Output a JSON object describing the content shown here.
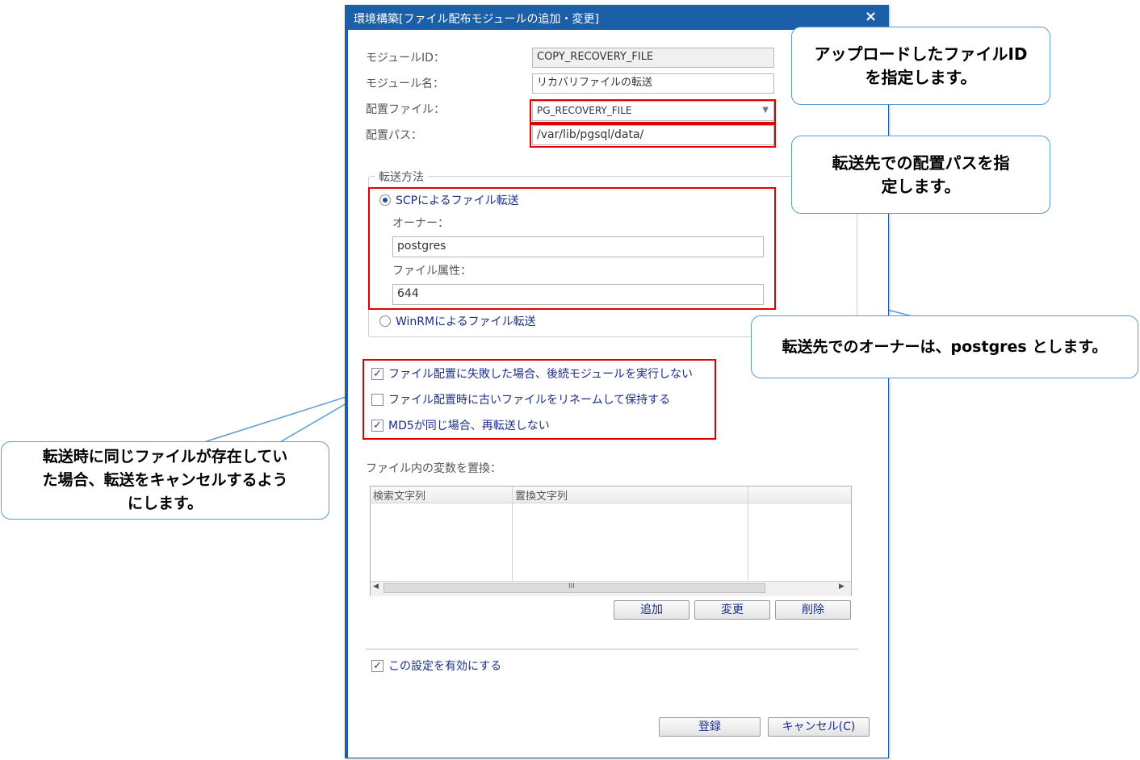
{
  "dialog": {
    "title": "環境構築[ファイル配布モジュールの追加・変更]",
    "close": "×"
  },
  "form": {
    "module_id_label": "モジュールID：",
    "module_id_value": "COPY_RECOVERY_FILE",
    "module_name_label": "モジュール名：",
    "module_name_value": "リカバリファイルの転送",
    "deploy_file_label": "配置ファイル：",
    "deploy_file_value": "PG_RECOVERY_FILE",
    "deploy_path_label": "配置パス：",
    "deploy_path_value": "/var/lib/pgsql/data/"
  },
  "transfer": {
    "legend": "転送方法",
    "scp_label": "SCPによるファイル転送",
    "owner_label": "オーナー：",
    "owner_value": "postgres",
    "attr_label": "ファイル属性：",
    "attr_value": "644",
    "winrm_label": "WinRMによるファイル転送"
  },
  "options": [
    {
      "label": "ファイル配置に失敗した場合、後続モジュールを実行しない",
      "checked": true
    },
    {
      "label": "ファイル配置時に古いファイルをリネームして保持する",
      "checked": false
    },
    {
      "label": "MD5が同じ場合、再転送しない",
      "checked": true
    }
  ],
  "replace": {
    "label": "ファイル内の変数を置換：",
    "col_search": "検索文字列",
    "col_replace": "置換文字列",
    "scroll_mid": "III",
    "add": "追加",
    "change": "変更",
    "delete": "削除"
  },
  "enable": {
    "label": "この設定を有効にする",
    "checked": true
  },
  "footer": {
    "register": "登録",
    "cancel": "キャンセル(C)"
  },
  "callouts": {
    "file_id_line1": "アップロードしたファイルID",
    "file_id_line2": "を指定します。",
    "path_line1": "転送先での配置パスを指",
    "path_line2": "定します。",
    "owner": "転送先でのオーナーは、postgres とします。",
    "md5_line1": "転送時に同じファイルが存在してい",
    "md5_line2": "た場合、転送をキャンセルするよう",
    "md5_line3": "にします。"
  },
  "colors": {
    "title_bar": "#1a5fa7",
    "highlight": "#e10000",
    "callout_border": "#5b9bd5",
    "option_text": "#1b2e8c"
  }
}
